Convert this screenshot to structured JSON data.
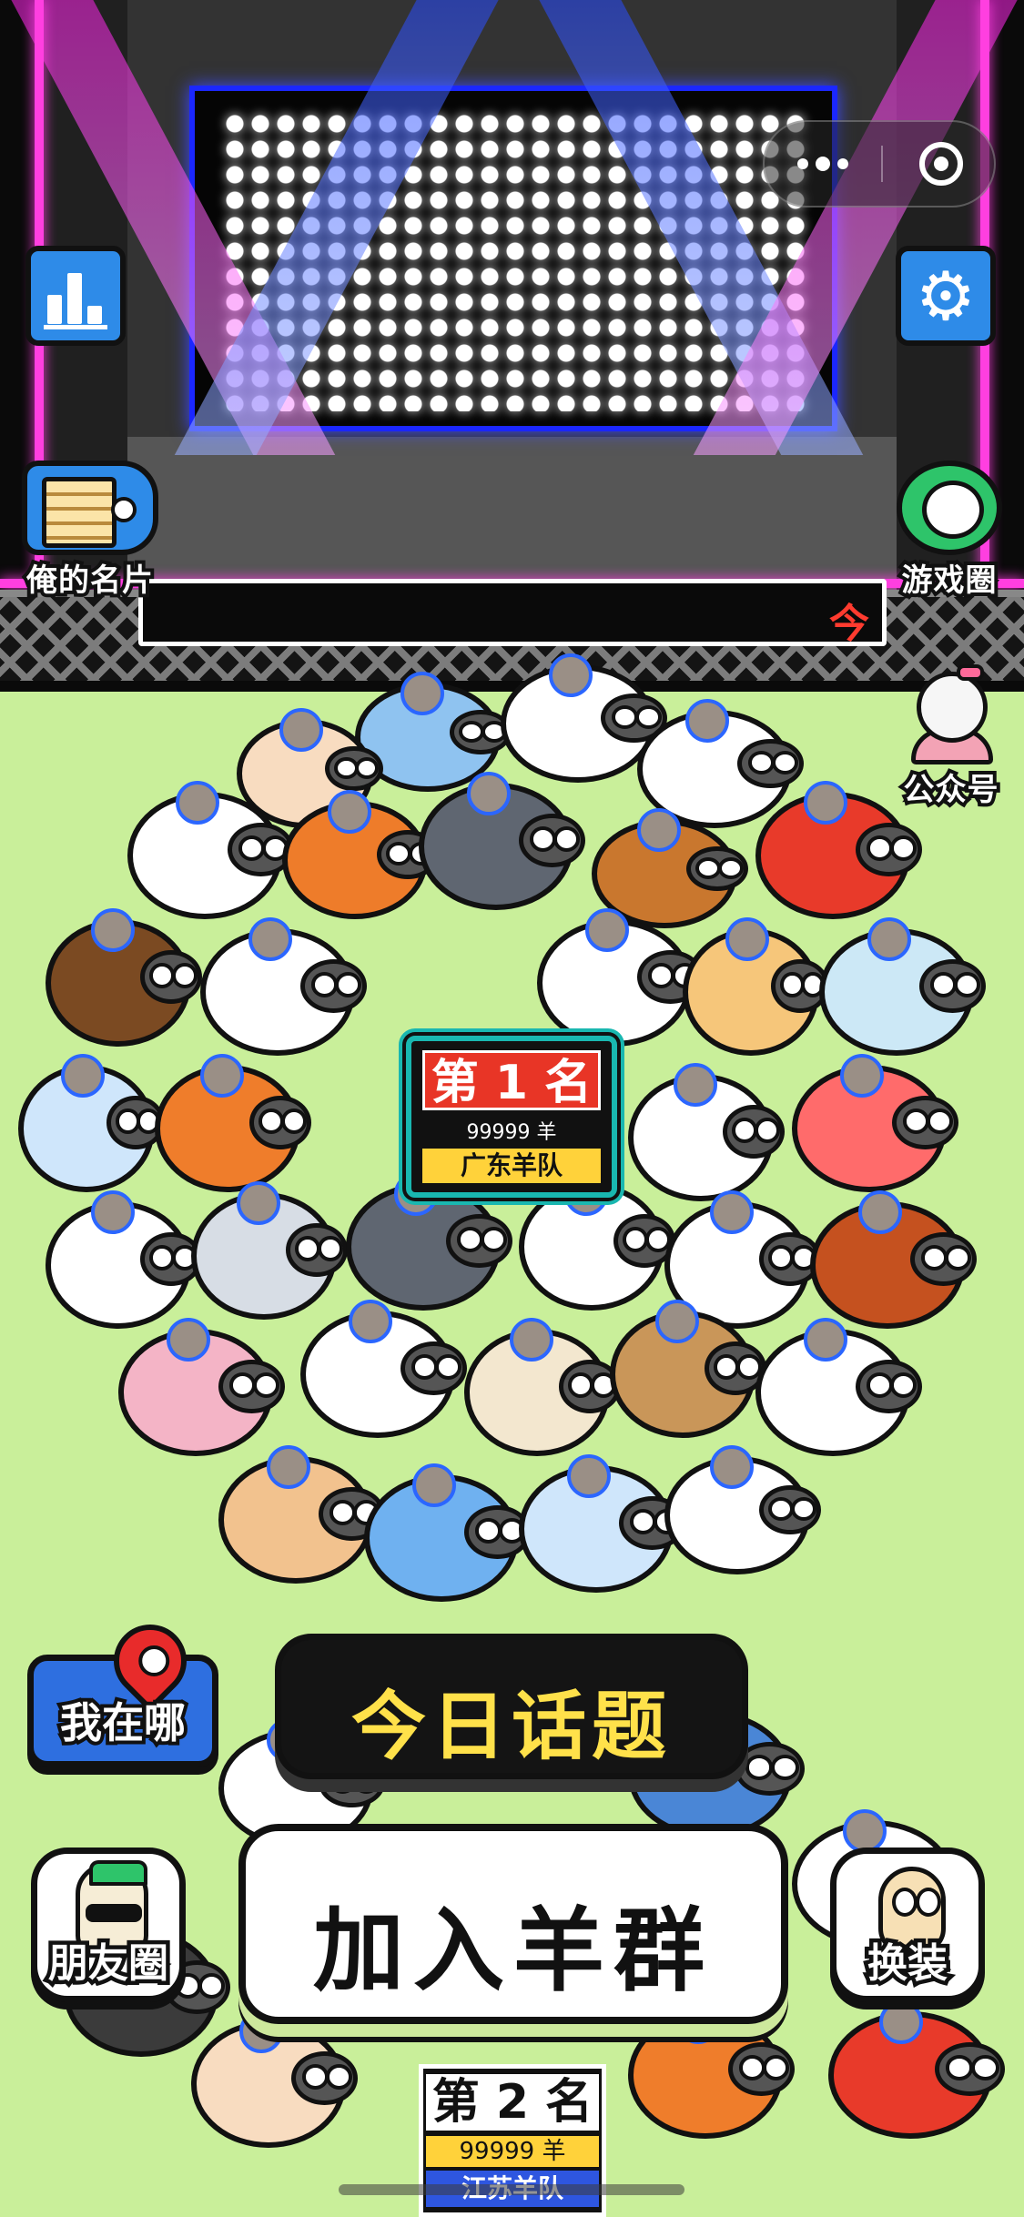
{
  "stage": {
    "ticker_text": "今",
    "beam_colors": {
      "magenta": "#ff1fe8",
      "blue": "#2246ff"
    },
    "screen_border_color": "#1b27ff",
    "neon_color": "#ff3fe0"
  },
  "capsule": {
    "menu_icon": "more-dots-icon",
    "close_icon": "record-circle-icon"
  },
  "side_buttons": {
    "stats_icon": "bar-chart-icon",
    "settings_icon": "gear-icon",
    "my_card_label": "俺的名片",
    "game_circle_label": "游戏圈",
    "official_account_label": "公众号"
  },
  "first_place": {
    "rank": "第 1 名",
    "score": "99999 羊",
    "team": "广东羊队"
  },
  "controls": {
    "where_label": "我在哪",
    "topic_label": "今日话题",
    "friends_label": "朋友圈",
    "join_label": "加入羊群",
    "outfit_label": "换装"
  },
  "second_place": {
    "rank": "第 2 名",
    "score": "99999 羊",
    "team": "江苏羊队"
  },
  "colors": {
    "background": "#c9ef9a",
    "accent_blue": "#2e8be8",
    "rank1_red": "#e83526",
    "team_yellow": "#ffd23a",
    "topic_yellow": "#ffe14a"
  }
}
